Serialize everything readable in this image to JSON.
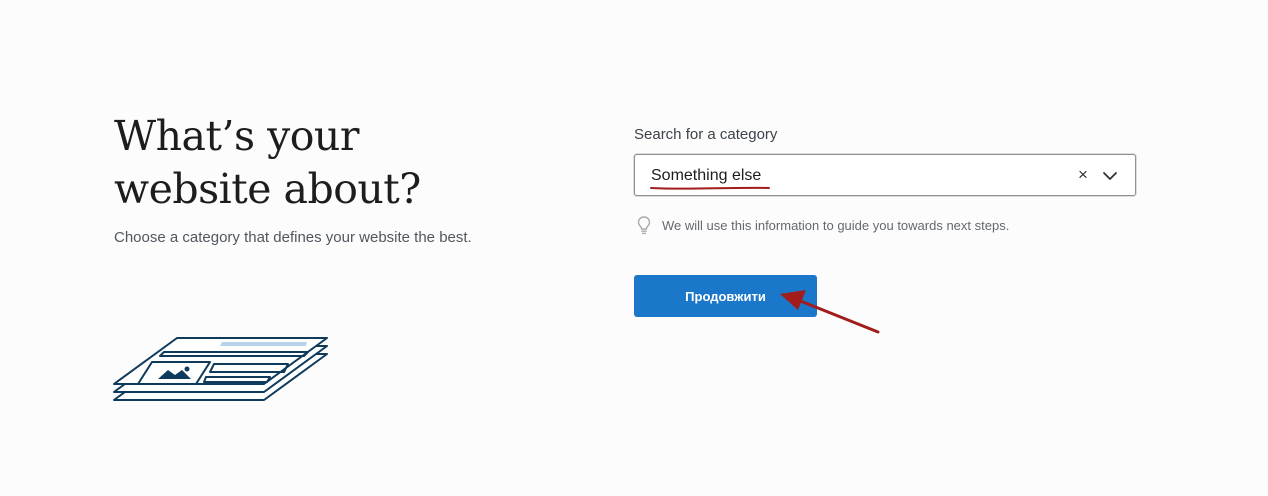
{
  "intro": {
    "headline_line1": "What’s your",
    "headline_line2": "website about?",
    "subtitle": "Choose a category that defines your website the best."
  },
  "category_search": {
    "label": "Search for a category",
    "selected_value": "Something else",
    "clear_symbol": "×",
    "hint": "We will use this information to guide you towards next steps."
  },
  "actions": {
    "continue_label": "Продовжити"
  },
  "colors": {
    "primary_button": "#1b77c9",
    "annotation": "#a31c1c",
    "illustration_stroke": "#0e3a5c",
    "illustration_fill": "#b7d3ec"
  },
  "icons": {
    "hint": "lightbulb-icon",
    "clear": "close-icon",
    "toggle": "chevron-down-icon"
  }
}
